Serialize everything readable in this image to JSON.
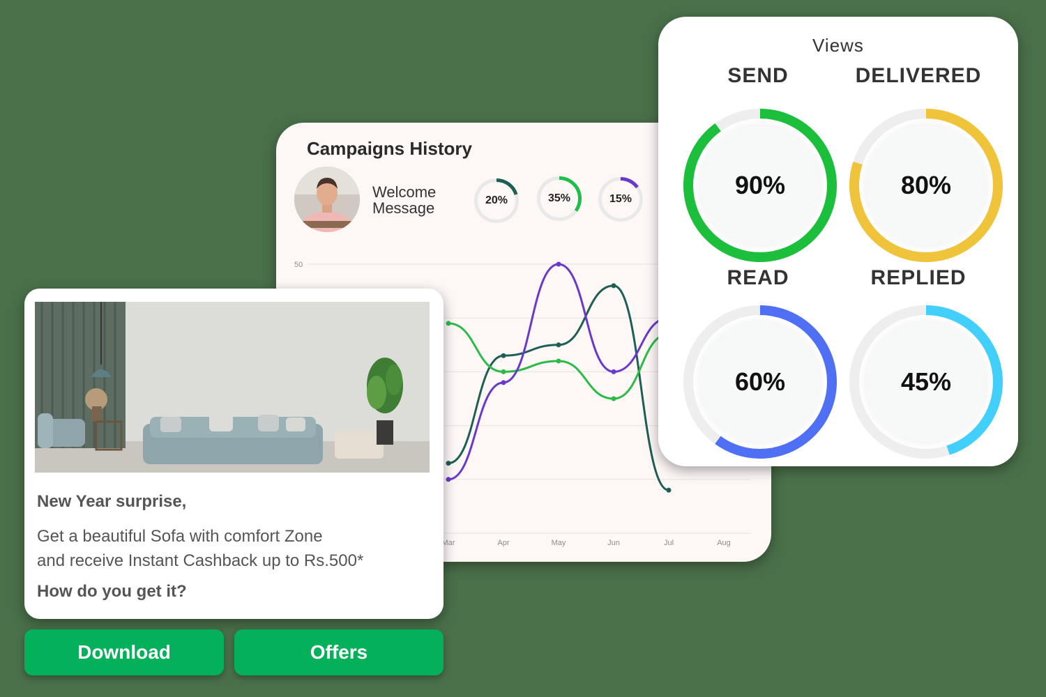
{
  "campaign": {
    "title": "Campaigns History",
    "welcome_line1": "Welcome",
    "welcome_line2": "Message",
    "mini_rings": [
      {
        "label": "20%",
        "value": 0.2,
        "color": "#1d5e55"
      },
      {
        "label": "35%",
        "value": 0.35,
        "color": "#1cbf4a"
      },
      {
        "label": "15%",
        "value": 0.15,
        "color": "#6a39c9"
      }
    ]
  },
  "chart_data": {
    "type": "line",
    "categories": [
      "Mar",
      "Apr",
      "May",
      "Jun",
      "Jul",
      "Aug"
    ],
    "y_tick_labels": [
      "50"
    ],
    "ylim": [
      0,
      50
    ],
    "grid": true,
    "series": [
      {
        "color": "#1d5e55",
        "values": [
          13,
          33,
          35,
          46,
          8,
          null
        ]
      },
      {
        "color": "#2dbb48",
        "values": [
          39,
          30,
          32,
          25,
          37,
          null
        ]
      },
      {
        "color": "#6a39c9",
        "values": [
          10,
          28,
          50,
          30,
          40,
          null
        ]
      }
    ]
  },
  "views": {
    "title": "Views",
    "metrics": [
      {
        "label": "SEND",
        "pct": "90%",
        "value": 0.9,
        "color": "#1cbf3c"
      },
      {
        "label": "DELIVERED",
        "pct": "80%",
        "value": 0.8,
        "color": "#efc43a"
      },
      {
        "label": "READ",
        "pct": "60%",
        "value": 0.6,
        "color": "#4f70f5"
      },
      {
        "label": "REPLIED",
        "pct": "45%",
        "value": 0.45,
        "color": "#43cffb"
      }
    ]
  },
  "offer": {
    "heading": "New Year surprise,",
    "line1": "Get a beautiful Sofa with comfort Zone",
    "line2": "and receive Instant Cashback up to Rs.500*",
    "question": "How do you get it?"
  },
  "buttons": {
    "download": "Download",
    "offers": "Offers"
  }
}
